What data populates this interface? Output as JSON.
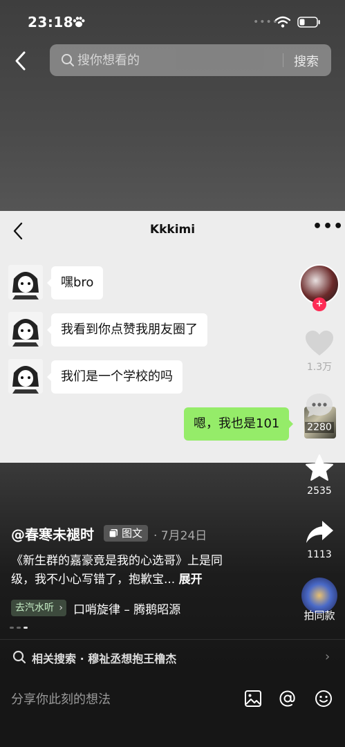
{
  "status_bar": {
    "time": "23:18",
    "signal_dots": "••••"
  },
  "search": {
    "placeholder": "搜你想看的",
    "button_label": "搜索"
  },
  "chat_screenshot": {
    "title": "Kkkimi",
    "more": "•••",
    "messages": [
      {
        "from": "other",
        "text": "嘿bro"
      },
      {
        "from": "other",
        "text": "我看到你点赞我朋友圈了"
      },
      {
        "from": "other",
        "text": "我们是一个学校的吗"
      },
      {
        "from": "me",
        "text": "嗯，我也是101"
      }
    ]
  },
  "rail": {
    "follow_badge": "+",
    "like_count": "1.3万",
    "comment_count": "2280",
    "favorite_count": "2535",
    "share_count": "1113",
    "same_style_label": "拍同款"
  },
  "post": {
    "author": "@春寒未褪时",
    "type_tag": "图文",
    "date": "· 7月24日",
    "description": "《新生群的嘉豪竟是我的心选哥》上是同级，我不小心写错了，抱歉宝...",
    "more_label": "展开",
    "music_chip": "去汽水听",
    "music_title": "口哨旋律 – 腾鹅昭源"
  },
  "related": {
    "text": "相关搜索 · 穆祉丞想抱王橹杰"
  },
  "composer": {
    "placeholder": "分享你此刻的想法"
  },
  "colors": {
    "accent_red": "#fe2c55",
    "my_bubble": "#95ec69",
    "chat_bg": "#ededed"
  }
}
